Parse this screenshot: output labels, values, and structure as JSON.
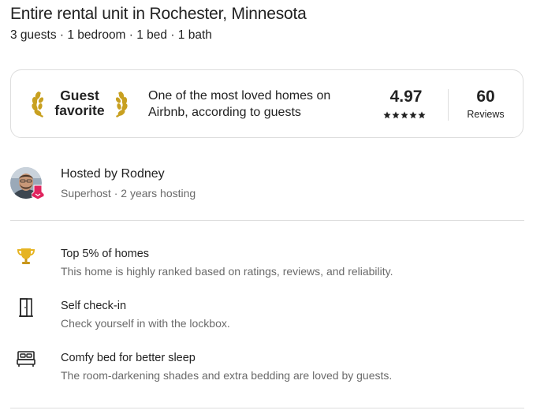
{
  "listing": {
    "title": "Entire rental unit in Rochester, Minnesota",
    "subtitle": "3 guests · 1 bedroom · 1 bed · 1 bath"
  },
  "guest_favorite": {
    "label_line1": "Guest",
    "label_line2": "favorite",
    "description": "One of the most loved homes on Airbnb, according to guests",
    "rating": "4.97",
    "stars": 5,
    "reviews_count": "60",
    "reviews_label": "Reviews",
    "accent_color": "#c8a020"
  },
  "host": {
    "name": "Hosted by Rodney",
    "meta": "Superhost · 2 years hosting",
    "badge_color": "#e0245e"
  },
  "highlights": [
    {
      "icon": "trophy-icon",
      "title": "Top 5% of homes",
      "description": "This home is highly ranked based on ratings, reviews, and reliability."
    },
    {
      "icon": "door-icon",
      "title": "Self check-in",
      "description": "Check yourself in with the lockbox."
    },
    {
      "icon": "bed-icon",
      "title": "Comfy bed for better sleep",
      "description": "The room-darkening shades and extra bedding are loved by guests."
    }
  ]
}
